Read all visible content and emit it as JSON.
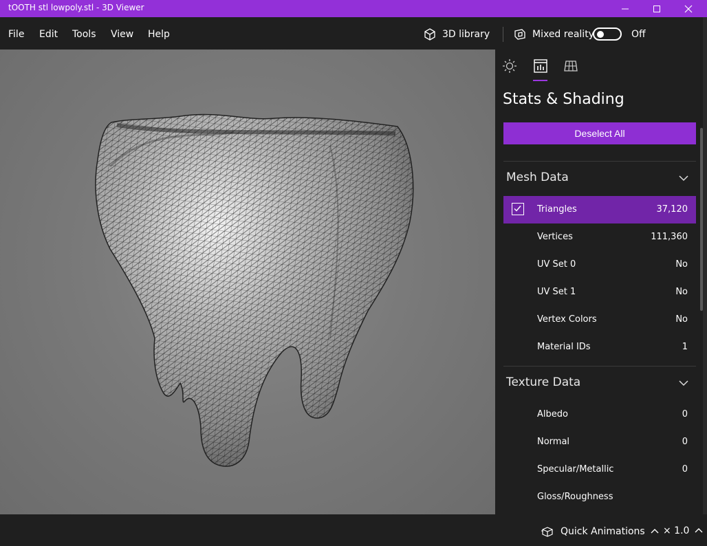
{
  "window": {
    "title": "tOOTH stl lowpoly.stl - 3D Viewer"
  },
  "menu": {
    "file": "File",
    "edit": "Edit",
    "tools": "Tools",
    "view": "View",
    "help": "Help"
  },
  "toolbar": {
    "library": "3D library",
    "mixed_reality": "Mixed reality",
    "toggle_state": "Off"
  },
  "panel": {
    "title": "Stats & Shading",
    "deselect": "Deselect All",
    "mesh_section": "Mesh Data",
    "mesh_rows": [
      {
        "label": "Triangles",
        "value": "37,120"
      },
      {
        "label": "Vertices",
        "value": "111,360"
      },
      {
        "label": "UV Set 0",
        "value": "No"
      },
      {
        "label": "UV Set 1",
        "value": "No"
      },
      {
        "label": "Vertex Colors",
        "value": "No"
      },
      {
        "label": "Material IDs",
        "value": "1"
      }
    ],
    "texture_section": "Texture Data",
    "texture_rows": [
      {
        "label": "Albedo",
        "value": "0"
      },
      {
        "label": "Normal",
        "value": "0"
      },
      {
        "label": "Specular/Metallic",
        "value": "0"
      },
      {
        "label": "Gloss/Roughness",
        "value": ""
      }
    ]
  },
  "bottom": {
    "quick_animations": "Quick Animations",
    "speed": "× 1.0"
  },
  "colors": {
    "accent": "#9330d8",
    "selected_row": "#7125a8",
    "viewport": "#7a7a7a"
  }
}
